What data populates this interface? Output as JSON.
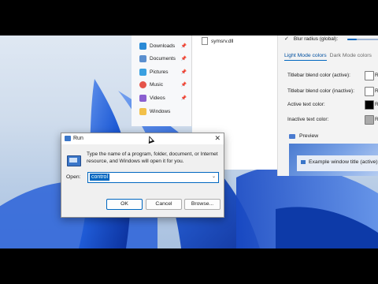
{
  "explorer": {
    "items": [
      {
        "label": "Downloads",
        "icon": "download-icon",
        "color": "#2a8ad6"
      },
      {
        "label": "Documents",
        "icon": "document-icon",
        "color": "#5b8fcf"
      },
      {
        "label": "Pictures",
        "icon": "picture-icon",
        "color": "#3aa0e0"
      },
      {
        "label": "Music",
        "icon": "music-icon",
        "color": "#e5544a"
      },
      {
        "label": "Videos",
        "icon": "video-icon",
        "color": "#8a5fd0"
      },
      {
        "label": "Windows",
        "icon": "folder-icon",
        "color": "#f2c04a"
      }
    ],
    "pin_glyph": "📌"
  },
  "files": {
    "items": [
      {
        "name": "symsrv.dll"
      }
    ]
  },
  "settings": {
    "blur_label": "Blur radius (global):",
    "blur_level": 0.3,
    "tabs": [
      "Light Mode colors",
      "Dark Mode colors"
    ],
    "rows": [
      {
        "label": "Titlebar blend color (active):",
        "swatch": "#ffffff",
        "tag": "R"
      },
      {
        "label": "Titlebar blend color (inactive):",
        "swatch": "#ffffff",
        "tag": "R"
      },
      {
        "label": "Active text color:",
        "swatch": "#000000",
        "tag": "R"
      },
      {
        "label": "Inactive text color:",
        "swatch": "#aaaaaa",
        "tag": "R"
      }
    ],
    "preview_label": "Preview",
    "preview_window_title": "Example window title (active)"
  },
  "run": {
    "title": "Run",
    "description": "Type the name of a program, folder, document, or Internet resource, and Windows will open it for you.",
    "open_label": "Open:",
    "open_value": "control",
    "ok": "OK",
    "cancel": "Cancel",
    "browse": "Browse..."
  },
  "colors": {
    "accent": "#0067c0",
    "desktop_bloom": "#1f5bd6"
  }
}
